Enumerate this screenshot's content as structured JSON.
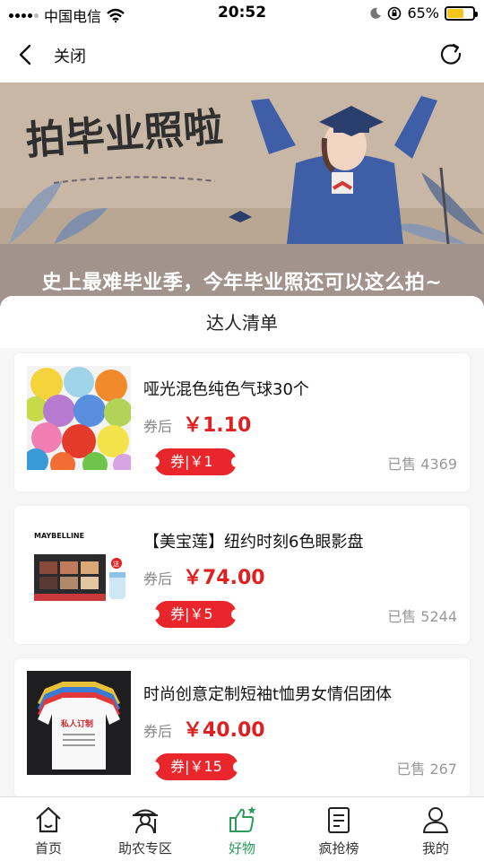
{
  "status_bar": {
    "carrier": "中国电信",
    "time": "20:52",
    "battery": "65%",
    "battery_level": 0.65
  },
  "nav": {
    "close_label": "关闭"
  },
  "banner": {
    "art_title": "拍毕业照啦",
    "headline": "史上最难毕业季，今年毕业照还可以这么拍~"
  },
  "sheet": {
    "title": "达人清单",
    "after_coupon_label": "券后",
    "products": [
      {
        "name": "哑光混色纯色气球30个",
        "price": "￥1.10",
        "coupon": "券|￥1",
        "sold": "已售 4369"
      },
      {
        "name": "【美宝莲】纽约时刻6色眼影盘",
        "price": "￥74.00",
        "coupon": "券|￥5",
        "sold": "已售 5244",
        "thumb_brand": "MAYBELLINE",
        "thumb_gift": "送"
      },
      {
        "name": "时尚创意定制短袖t恤男女情侣团体",
        "price": "￥40.00",
        "coupon": "券|￥15",
        "sold": "已售 267",
        "thumb_text": "私人订制"
      }
    ]
  },
  "tabbar": {
    "tabs": [
      {
        "label": "首页",
        "icon": "home-icon"
      },
      {
        "label": "助农专区",
        "icon": "farmer-icon"
      },
      {
        "label": "好物",
        "icon": "thumbs-up-icon"
      },
      {
        "label": "疯抢榜",
        "icon": "list-icon"
      },
      {
        "label": "我的",
        "icon": "user-icon"
      }
    ],
    "active_index": 2
  },
  "colors": {
    "accent_green": "#2a9d5a",
    "price_red": "#e02020",
    "coupon_red": "#e8262c",
    "banner_bg": "#a2948c"
  }
}
